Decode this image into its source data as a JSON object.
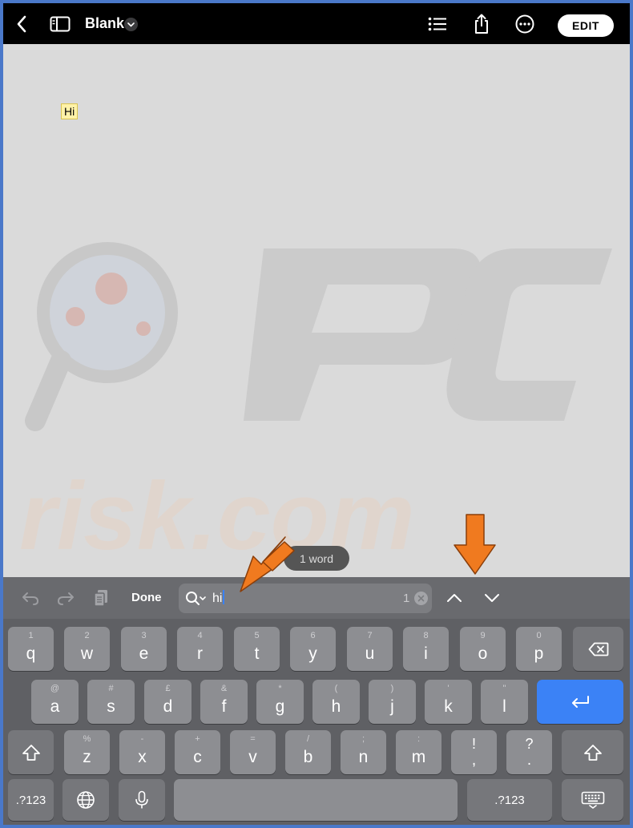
{
  "navbar": {
    "title": "Blank",
    "edit_label": "EDIT",
    "icons": [
      "back-icon",
      "sidebar-icon",
      "chevron-down-icon",
      "list-icon",
      "share-icon",
      "more-icon"
    ]
  },
  "canvas": {
    "highlighted_text": "Hi",
    "word_count": "1 word"
  },
  "find_toolbar": {
    "done_label": "Done",
    "search_value": "hi",
    "match_count": "1",
    "icons": [
      "undo-icon",
      "redo-icon",
      "clipboard-icon",
      "search-icon",
      "clear-icon",
      "previous-match-icon",
      "next-match-icon"
    ]
  },
  "keyboard": {
    "row1": [
      {
        "hint": "1",
        "key": "q"
      },
      {
        "hint": "2",
        "key": "w"
      },
      {
        "hint": "3",
        "key": "e"
      },
      {
        "hint": "4",
        "key": "r"
      },
      {
        "hint": "5",
        "key": "t"
      },
      {
        "hint": "6",
        "key": "y"
      },
      {
        "hint": "7",
        "key": "u"
      },
      {
        "hint": "8",
        "key": "i"
      },
      {
        "hint": "9",
        "key": "o"
      },
      {
        "hint": "0",
        "key": "p"
      }
    ],
    "row2": [
      {
        "hint": "@",
        "key": "a"
      },
      {
        "hint": "#",
        "key": "s"
      },
      {
        "hint": "£",
        "key": "d"
      },
      {
        "hint": "&",
        "key": "f"
      },
      {
        "hint": "*",
        "key": "g"
      },
      {
        "hint": "(",
        "key": "h"
      },
      {
        "hint": ")",
        "key": "j"
      },
      {
        "hint": "'",
        "key": "k"
      },
      {
        "hint": "\"",
        "key": "l"
      }
    ],
    "row3": [
      {
        "hint": "%",
        "key": "z"
      },
      {
        "hint": "-",
        "key": "x"
      },
      {
        "hint": "+",
        "key": "c"
      },
      {
        "hint": "=",
        "key": "v"
      },
      {
        "hint": "/",
        "key": "b"
      },
      {
        "hint": ";",
        "key": "n"
      },
      {
        "hint": ":",
        "key": "m"
      },
      {
        "hint": "!",
        "key": ","
      },
      {
        "hint": "?",
        "key": "."
      }
    ],
    "numbers_label": ".?123",
    "numbers_label_right": ".?123"
  },
  "colors": {
    "return_key": "#3b82f6",
    "annotation_arrow": "#f07a1f",
    "highlight": "#fff2a8"
  }
}
